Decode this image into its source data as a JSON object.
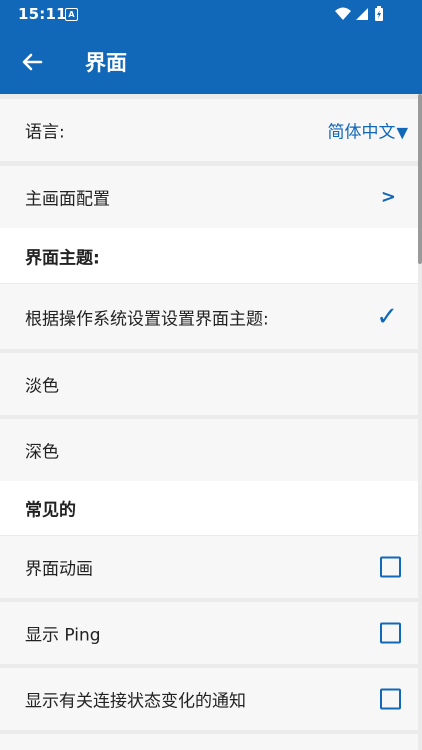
{
  "status": {
    "time": "15:11",
    "a_badge": "A"
  },
  "appbar": {
    "title": "界面"
  },
  "rows": {
    "language": {
      "label": "语言:",
      "value": "简体中文",
      "caret": "▼"
    },
    "home_config": {
      "label": "主画面配置",
      "chevron": ">"
    },
    "theme_header": {
      "label": "界面主题:"
    },
    "theme_system": {
      "label": "根据操作系统设置设置界面主题:",
      "check": "✓"
    },
    "theme_light": {
      "label": "淡色"
    },
    "theme_dark": {
      "label": "深色"
    },
    "common_header": {
      "label": "常见的"
    },
    "ui_animation": {
      "label": "界面动画",
      "checked": false
    },
    "show_ping": {
      "label": "显示 Ping",
      "checked": false
    },
    "conn_notify": {
      "label": "显示有关连接状态变化的通知",
      "checked": false
    }
  },
  "colors": {
    "accent": "#1167b8",
    "row_bg": "#f7f7f7",
    "section_bg": "#ffffff",
    "divider": "#ebebeb"
  },
  "icons": {
    "back": "back-arrow-icon",
    "wifi": "wifi-icon",
    "signal": "cell-signal-icon",
    "battery": "battery-charging-icon"
  }
}
